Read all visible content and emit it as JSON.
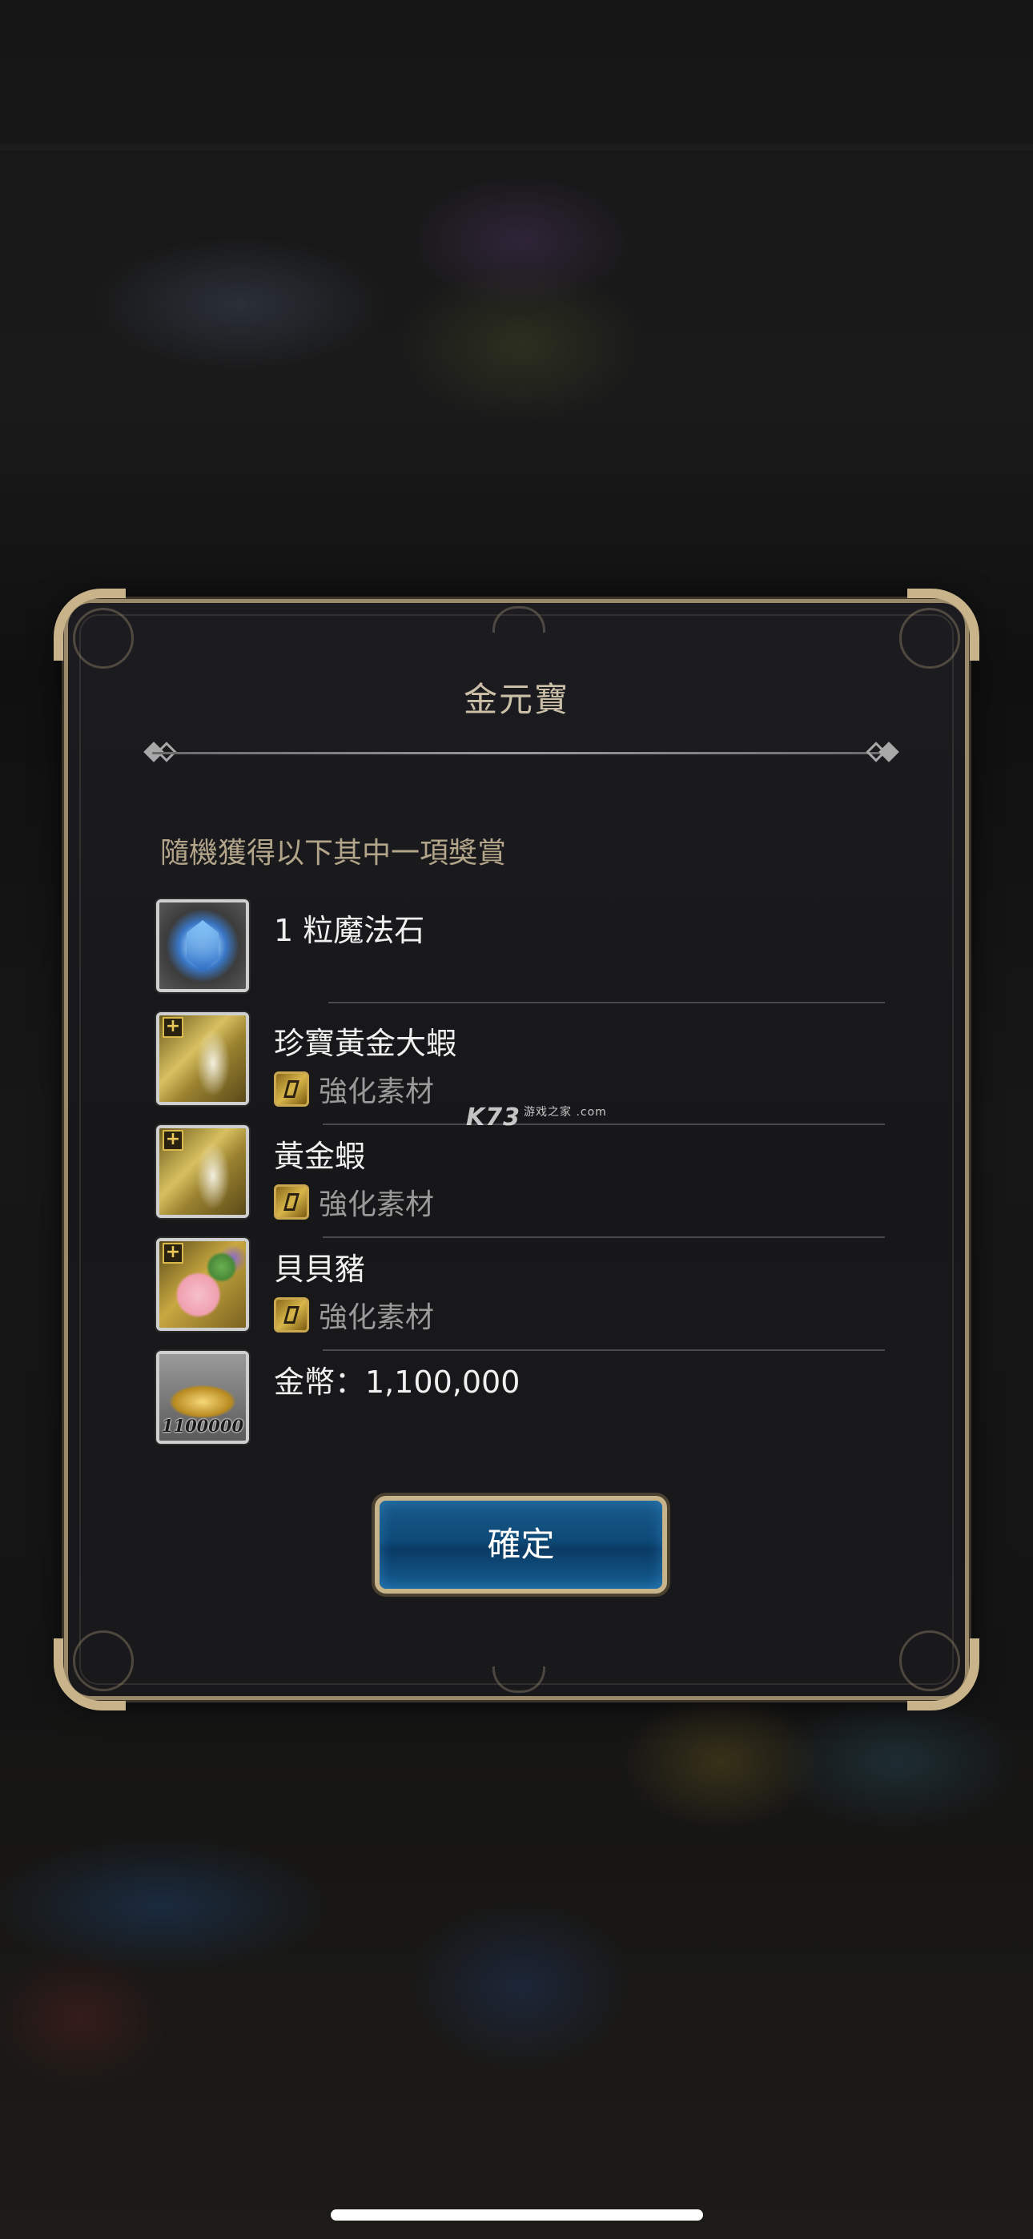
{
  "dialog": {
    "title": "金元寶",
    "subtitle": "隨機獲得以下其中一項獎賞",
    "confirm_label": "確定"
  },
  "rewards": [
    {
      "name": "1 粒魔法石",
      "tag": "",
      "icon": "magic-stone-icon"
    },
    {
      "name": "珍寶黃金大蝦",
      "tag": "強化素材",
      "icon": "golden-shrimp-card-icon"
    },
    {
      "name": "黃金蝦",
      "tag": "強化素材",
      "icon": "gold-shrimp-card-icon"
    },
    {
      "name": "貝貝豬",
      "tag": "強化素材",
      "icon": "piggy-card-icon"
    },
    {
      "name": "金幣：1,100,000",
      "tag": "",
      "icon": "gold-coins-icon",
      "badge_text": "1100000"
    }
  ],
  "watermark": {
    "brand": "K73",
    "sub": "游戏之家 .com"
  },
  "colors": {
    "frame_gold": "#c8b38a",
    "button_blue": "#0e4a78",
    "title_text": "#cbbfa8",
    "subtitle_text": "#b2a58a"
  }
}
